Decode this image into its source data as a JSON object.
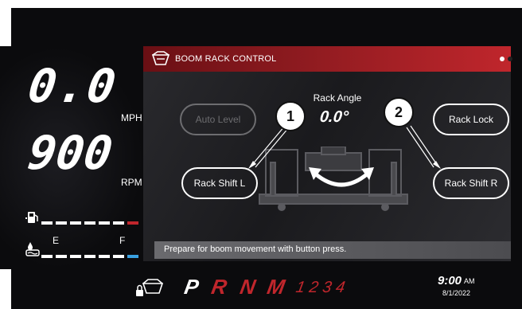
{
  "speedometer": {
    "speed": "0.0",
    "speed_unit": "MPH",
    "rpm": "900",
    "rpm_unit": "RPM"
  },
  "levels": {
    "empty_label": "E",
    "full_label": "F"
  },
  "panel": {
    "title": "BOOM RACK CONTROL",
    "buttons": {
      "auto_level": "Auto Level",
      "rack_lock": "Rack Lock",
      "shift_left": "Rack Shift L",
      "shift_right": "Rack Shift R"
    },
    "rack_angle_label": "Rack Angle",
    "rack_angle_value": "0.0°",
    "callouts": [
      "1",
      "2"
    ],
    "status_message": "Prepare for boom movement with button press."
  },
  "gears": {
    "P": "P",
    "R": "R",
    "N": "N",
    "M": "M",
    "numbers": "1 2 3 4"
  },
  "clock": {
    "time": "9:00",
    "ampm": "AM",
    "date": "8/1/2022"
  },
  "colors": {
    "accent_red": "#c0262c",
    "header_dark_red": "#6a0f14",
    "blue_indicator": "#39a0e0"
  }
}
